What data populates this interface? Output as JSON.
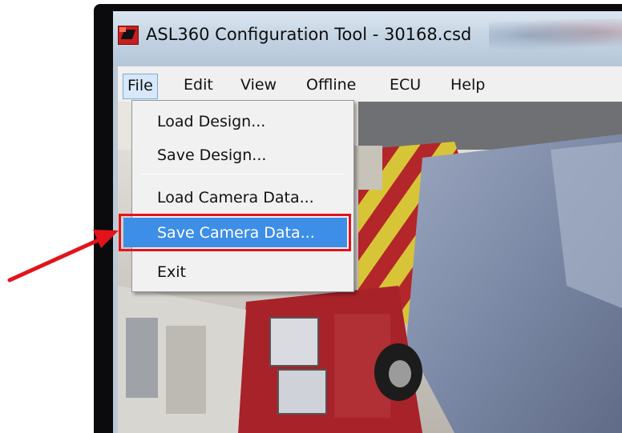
{
  "window": {
    "title": "ASL360 Configuration Tool - 30168.csd",
    "app_icon": "asl360-app-icon"
  },
  "menubar": {
    "items": [
      "File",
      "Edit",
      "View",
      "Offline",
      "ECU",
      "Help"
    ],
    "active": "File"
  },
  "file_menu": {
    "items": [
      {
        "label": "Load Design..."
      },
      {
        "label": "Save Design..."
      },
      {
        "label": "Load Camera Data..."
      },
      {
        "label": "Save Camera Data...",
        "selected": true
      },
      {
        "label": "Exit"
      }
    ]
  },
  "annotation": {
    "highlight_color": "#e3131b",
    "arrow_color": "#e3131b",
    "highlighted_item": "Save Camera Data..."
  },
  "colors": {
    "selection": "#3d8ee6",
    "menu_bg": "#f1f1f1",
    "frame": "#0b0b0d"
  }
}
